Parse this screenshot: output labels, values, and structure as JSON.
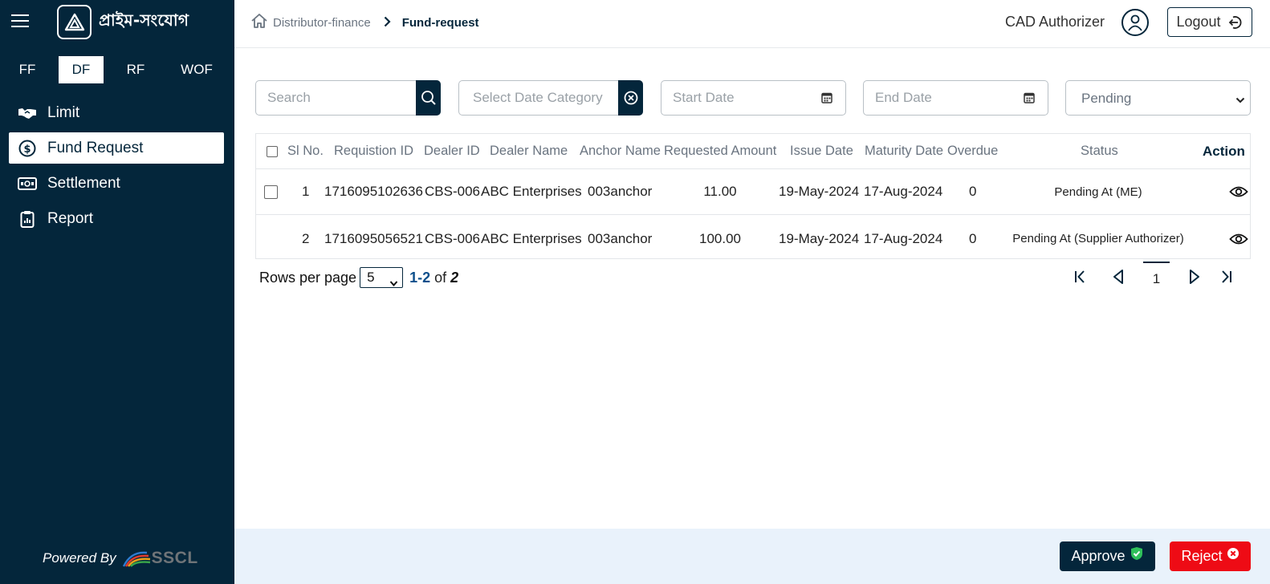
{
  "sidebar": {
    "brand_name": "প্রাইম-সংযোগ",
    "module_tabs": [
      "FF",
      "DF",
      "RF",
      "WOF"
    ],
    "active_module": "DF",
    "nav_items": [
      {
        "label": "Limit",
        "icon": "handshake-icon"
      },
      {
        "label": "Fund Request",
        "icon": "dollar-circle-icon"
      },
      {
        "label": "Settlement",
        "icon": "banknote-icon"
      },
      {
        "label": "Report",
        "icon": "clipboard-icon"
      }
    ],
    "active_nav": "Fund Request",
    "powered_by": "Powered By",
    "powered_logo_text": "SSCL"
  },
  "header": {
    "breadcrumb": [
      "Distributor-finance",
      "Fund-request"
    ],
    "user_role": "CAD Authorizer",
    "logout_label": "Logout"
  },
  "filters": {
    "search_placeholder": "Search",
    "date_category_placeholder": "Select Date Category",
    "start_date_placeholder": "Start Date",
    "end_date_placeholder": "End Date",
    "status_value": "Pending"
  },
  "table": {
    "columns": [
      "Sl No.",
      "Requistion ID",
      "Dealer ID",
      "Dealer Name",
      "Anchor Name",
      "Requested Amount",
      "Issue Date",
      "Maturity Date",
      "Overdue",
      "Status",
      "Action"
    ],
    "rows": [
      {
        "sl": "1",
        "requisition_id": "1716095102636",
        "dealer_id": "CBS-006",
        "dealer_name": "ABC Enterprises",
        "anchor_name": "003anchor",
        "amount": "11.00",
        "issue_date": "19-May-2024",
        "maturity_date": "17-Aug-2024",
        "overdue": "0",
        "status": "Pending At (ME)"
      },
      {
        "sl": "2",
        "requisition_id": "1716095056521",
        "dealer_id": "CBS-006",
        "dealer_name": "ABC Enterprises",
        "anchor_name": "003anchor",
        "amount": "100.00",
        "issue_date": "19-May-2024",
        "maturity_date": "17-Aug-2024",
        "overdue": "0",
        "status": "Pending At (Supplier Authorizer)"
      }
    ]
  },
  "pagination": {
    "rows_per_page_label": "Rows per page",
    "rows_per_page": "5",
    "range": "1-2",
    "of": "of",
    "total": "2",
    "current_page": "1"
  },
  "actions": {
    "approve_label": "Approve",
    "reject_label": "Reject"
  },
  "colors": {
    "sidebar_bg": "#04263b",
    "status_text": "#c48b69",
    "reject": "#ee0b15",
    "approve": "#04263b",
    "footer_bg": "#e9f2fb"
  }
}
